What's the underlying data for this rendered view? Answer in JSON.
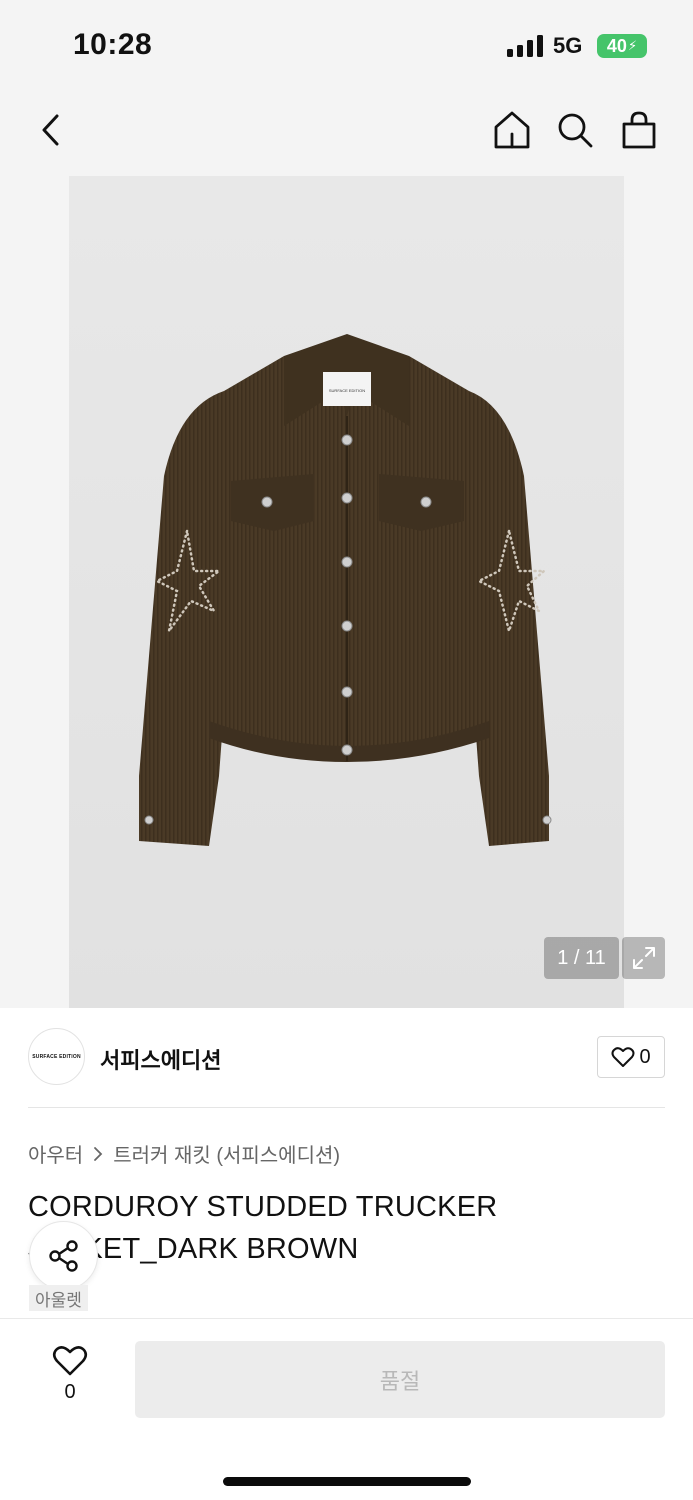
{
  "status_bar": {
    "time": "10:28",
    "network": "5G",
    "battery": "40"
  },
  "nav": {
    "icons": [
      "back-icon",
      "home-icon",
      "search-icon",
      "bag-icon"
    ]
  },
  "gallery": {
    "counter": "1 / 11",
    "label_on_product": "SURFACE EDITION"
  },
  "brand": {
    "logo_text": "SURFACE EDITION",
    "name": "서피스에디션",
    "likes": "0"
  },
  "breadcrumb": {
    "category": "아우터",
    "sub_category": "트러커 재킷 (서피스에디션)"
  },
  "product": {
    "title": "CORDUROY STUDDED TRUCKER JACKET_DARK BROWN",
    "tag": "아울렛"
  },
  "bottom": {
    "wish_count": "0",
    "buy_label": "품절"
  },
  "colors": {
    "jacket": "#4a3a26",
    "battery": "#45c46a"
  }
}
